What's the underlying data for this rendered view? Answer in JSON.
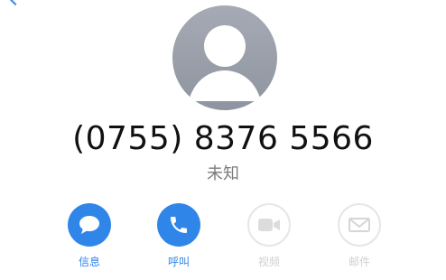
{
  "contact": {
    "phone_number": "(0755) 8376 5566",
    "label": "未知"
  },
  "actions": [
    {
      "id": "message",
      "label": "信息",
      "icon": "message-bubble-icon",
      "enabled": true
    },
    {
      "id": "call",
      "label": "呼叫",
      "icon": "phone-icon",
      "enabled": true
    },
    {
      "id": "video",
      "label": "视频",
      "icon": "video-camera-icon",
      "enabled": false
    },
    {
      "id": "mail",
      "label": "邮件",
      "icon": "envelope-icon",
      "enabled": false
    }
  ],
  "colors": {
    "accent": "#2f86e8",
    "disabled": "#cfcfcf",
    "avatar_bg": "#9a9fa9"
  }
}
